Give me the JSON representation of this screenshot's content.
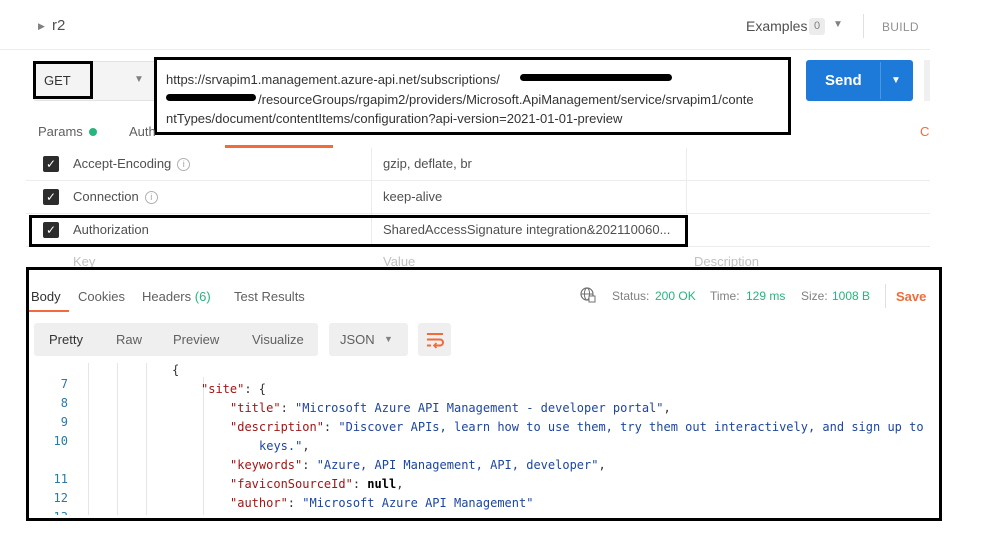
{
  "request": {
    "name": "r2",
    "examples_label": "Examples",
    "examples_count": "0",
    "build_label": "BUILD",
    "method": "GET",
    "url_prefix": "https://srvapim1.management.azure-api.net/subscriptions/",
    "url_mid": "/resourceGroups/rgapim2/providers/Microsoft.ApiManagement/service/srvapim1/conte",
    "url_suffix": "ntTypes/document/contentItems/configuration?api-version=2021-01-01-preview",
    "send_label": "Send"
  },
  "request_tabs": {
    "params": "Params",
    "auth": "Auth",
    "cut_right": "C"
  },
  "headers": [
    {
      "key": "Accept-Encoding",
      "value": "gzip, deflate, br",
      "checked": true,
      "info": true
    },
    {
      "key": "Connection",
      "value": "keep-alive",
      "checked": true,
      "info": true
    },
    {
      "key": "Authorization",
      "value": "SharedAccessSignature integration&202110060...",
      "checked": true,
      "info": false
    }
  ],
  "header_placeholders": {
    "key": "Key",
    "value": "Value",
    "description": "Description"
  },
  "response": {
    "tabs": {
      "body": "Body",
      "cookies": "Cookies",
      "headers": "Headers",
      "headers_count": "(6)",
      "tests": "Test Results"
    },
    "status_label": "Status:",
    "status_value": "200 OK",
    "time_label": "Time:",
    "time_value": "129 ms",
    "size_label": "Size:",
    "size_value": "1008 B",
    "save_label": "Save",
    "format_buttons": {
      "pretty": "Pretty",
      "raw": "Raw",
      "preview": "Preview",
      "visualize": "Visualize"
    },
    "format_select": "JSON"
  },
  "code": {
    "line_numbers": [
      "7",
      "8",
      "9",
      "10",
      "",
      "11",
      "12",
      "13"
    ],
    "l7": "{",
    "l8_key": "\"site\"",
    "l8_rest": ": {",
    "l9_key": "\"title\"",
    "l9_val": "\"Microsoft Azure API Management - developer portal\"",
    "l10_key": "\"description\"",
    "l10_val": "\"Discover APIs, learn how to use them, try them out interactively, and sign up to acc",
    "l10b_val": "keys.\"",
    "l11_key": "\"keywords\"",
    "l11_val": "\"Azure, API Management, API, developer\"",
    "l12_key": "\"faviconSourceId\"",
    "l12_val": "null",
    "l13_key": "\"author\"",
    "l13_val": "\"Microsoft Azure API Management\""
  },
  "colors": {
    "accent": "#f26b3a",
    "send_blue": "#1e7ad9",
    "status_green": "#26b47f"
  }
}
